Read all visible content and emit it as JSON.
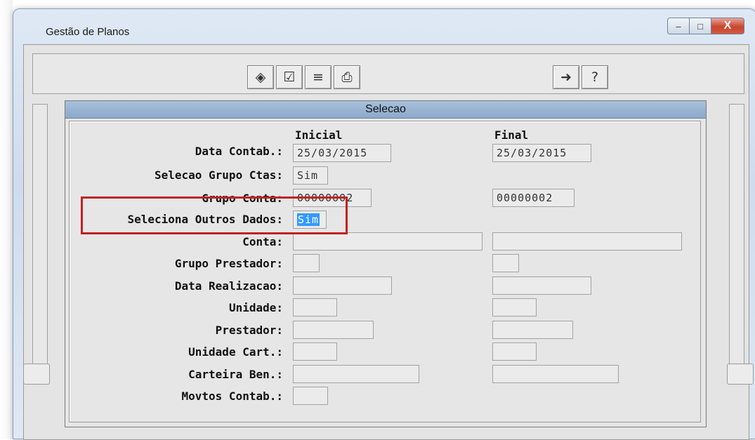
{
  "window": {
    "title": "Gestão de Planos",
    "controls": {
      "minimize": "–",
      "maximize": "□",
      "close": "X"
    }
  },
  "toolbar": {
    "left_buttons": [
      {
        "icon": "edit-icon",
        "glyph": "◈"
      },
      {
        "icon": "checklist-icon",
        "glyph": "☑"
      },
      {
        "icon": "list-icon",
        "glyph": "≡"
      },
      {
        "icon": "printer-icon",
        "glyph": "⎙"
      }
    ],
    "right_buttons": [
      {
        "icon": "exit-icon",
        "glyph": "➜"
      },
      {
        "icon": "help-icon",
        "glyph": "?"
      }
    ]
  },
  "dialog": {
    "title": "Selecao",
    "col_inicial": "Inicial",
    "col_final": "Final",
    "rows": [
      {
        "label": "Data Contab.:",
        "inicial": "25/03/2015",
        "final": "25/03/2015"
      },
      {
        "label": "Selecao Grupo Ctas:",
        "inicial": "Sim",
        "final": ""
      },
      {
        "label": "Grupo Conta:",
        "inicial": "00000002",
        "final": "00000002"
      },
      {
        "label": "Seleciona Outros Dados:",
        "inicial": "Sim",
        "final": ""
      },
      {
        "label": "Conta:",
        "inicial": "",
        "final": ""
      },
      {
        "label": "Grupo Prestador:",
        "inicial": "",
        "final": ""
      },
      {
        "label": "Data Realizacao:",
        "inicial": "",
        "final": ""
      },
      {
        "label": "Unidade:",
        "inicial": "",
        "final": ""
      },
      {
        "label": "Prestador:",
        "inicial": "",
        "final": ""
      },
      {
        "label": "Unidade Cart.:",
        "inicial": "",
        "final": ""
      },
      {
        "label": "Carteira Ben.:",
        "inicial": "",
        "final": ""
      },
      {
        "label": "Movtos Contab.:",
        "inicial": "",
        "final": ""
      }
    ]
  },
  "colors": {
    "highlight": "#c42020",
    "header": "#8ca9ca",
    "selection": "#3399ff"
  }
}
